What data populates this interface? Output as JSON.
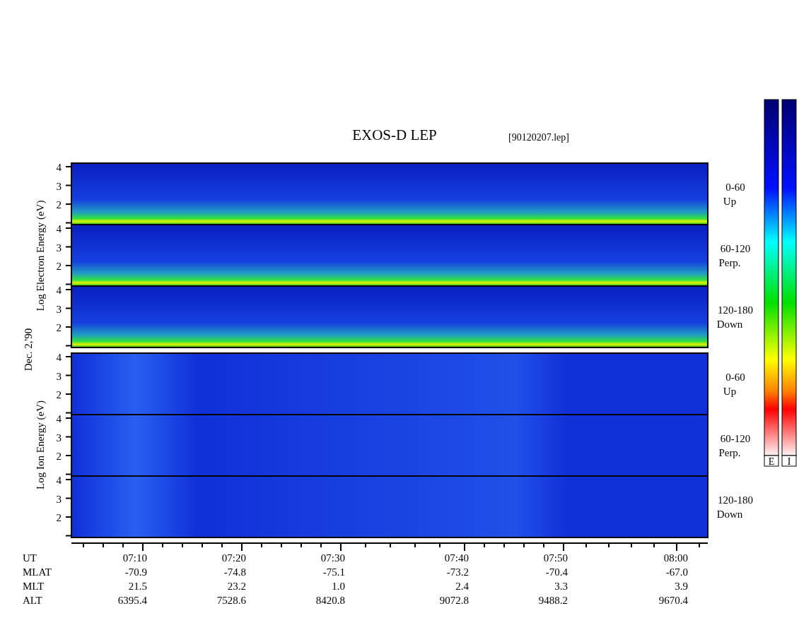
{
  "title": "EXOS-D LEP",
  "file": "[90120207.lep]",
  "date_label": "Dec. 2,'90",
  "groups": [
    {
      "kind": "electron",
      "axis_label": "Log  Electron  Energy (eV)",
      "panels": [
        {
          "range": "0-60",
          "direction": "Up",
          "ticks": [
            "4",
            "3",
            "2"
          ]
        },
        {
          "range": "60-120",
          "direction": "Perp.",
          "ticks": [
            "4",
            "3",
            "2"
          ]
        },
        {
          "range": "120-180",
          "direction": "Down",
          "ticks": [
            "4",
            "3",
            "2"
          ]
        }
      ]
    },
    {
      "kind": "ion",
      "axis_label": "Log  Ion  Energy (eV)",
      "panels": [
        {
          "range": "0-60",
          "direction": "Up",
          "ticks": [
            "4",
            "3",
            "2"
          ]
        },
        {
          "range": "60-120",
          "direction": "Perp.",
          "ticks": [
            "4",
            "3",
            "2"
          ]
        },
        {
          "range": "120-180",
          "direction": "Down",
          "ticks": [
            "4",
            "3",
            "2"
          ]
        }
      ]
    }
  ],
  "colorbars": [
    {
      "label": "E"
    },
    {
      "label": "I"
    }
  ],
  "ephemeris": [
    {
      "name": "UT",
      "values": [
        "07:10",
        "07:20",
        "07:30",
        "07:40",
        "07:50",
        "08:00"
      ]
    },
    {
      "name": "MLAT",
      "values": [
        "-70.9",
        "-74.8",
        "-75.1",
        "-73.2",
        "-70.4",
        "-67.0"
      ]
    },
    {
      "name": "MLT",
      "values": [
        "21.5",
        "23.2",
        "1.0",
        "2.4",
        "3.3",
        "3.9"
      ]
    },
    {
      "name": "ALT",
      "values": [
        "6395.4",
        "7528.6",
        "8420.8",
        "9072.8",
        "9488.2",
        "9670.4"
      ]
    }
  ]
}
